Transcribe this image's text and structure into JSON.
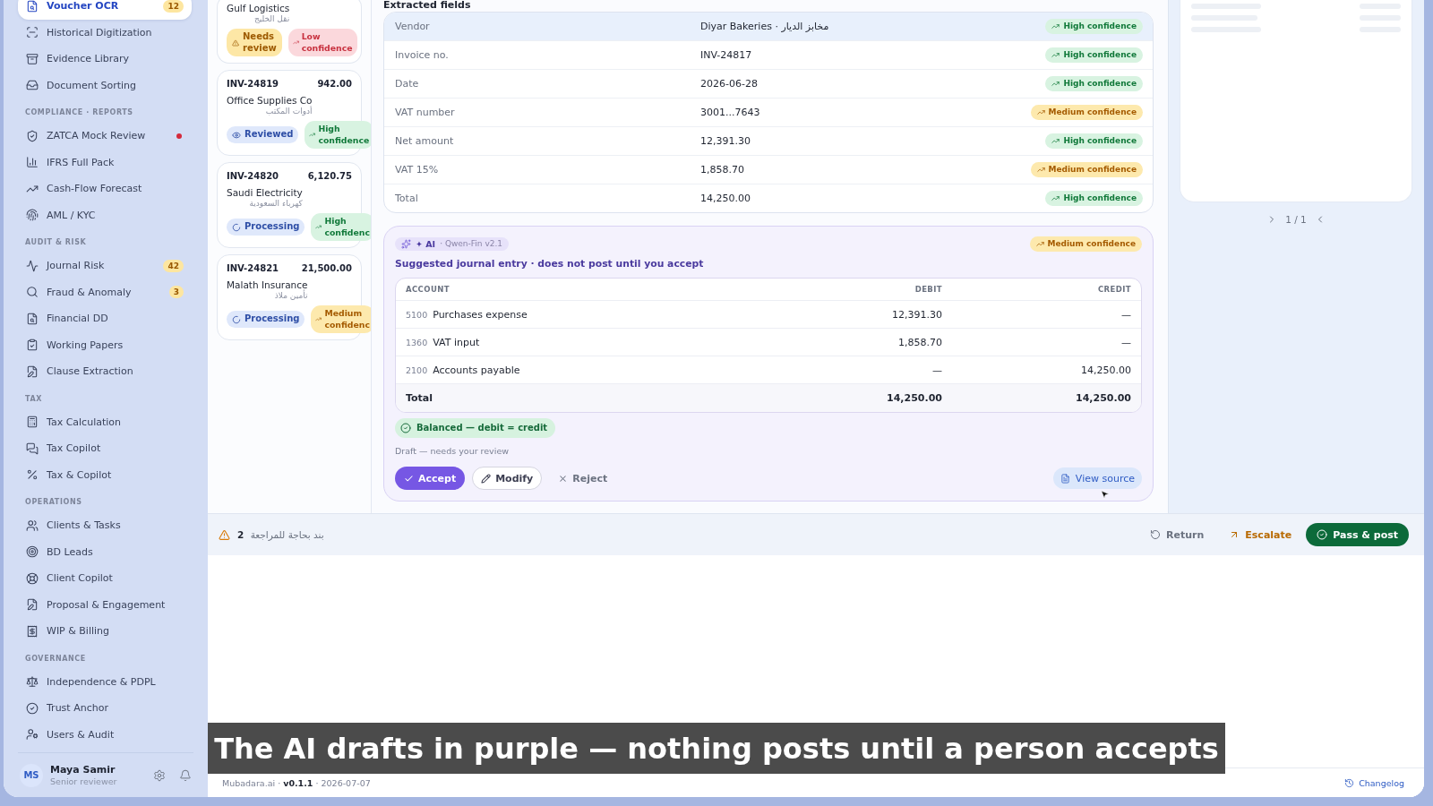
{
  "sidebar": {
    "groups": [
      {
        "items": [
          {
            "label": "Voucher OCR",
            "selected": true,
            "alert": false,
            "badge": "12"
          },
          {
            "label": "Historical Digitization",
            "selected": false,
            "alert": false
          },
          {
            "label": "Evidence Library",
            "selected": false,
            "alert": false
          },
          {
            "label": "Document Sorting",
            "selected": false,
            "alert": false
          }
        ]
      },
      {
        "heading": "COMPLIANCE · REPORTS",
        "items": [
          {
            "label": "ZATCA Mock Review",
            "selected": false,
            "alert": true
          },
          {
            "label": "IFRS Full Pack",
            "selected": false,
            "alert": false
          },
          {
            "label": "Cash-Flow Forecast",
            "selected": false,
            "alert": false
          },
          {
            "label": "AML / KYC",
            "selected": false,
            "alert": false
          }
        ]
      },
      {
        "heading": "AUDIT & RISK",
        "items": [
          {
            "label": "Journal Risk",
            "selected": false,
            "alert": false,
            "badge": "42"
          },
          {
            "label": "Fraud & Anomaly",
            "selected": false,
            "alert": false,
            "badge": "3"
          },
          {
            "label": "Financial DD",
            "selected": false,
            "alert": false
          },
          {
            "label": "Working Papers",
            "selected": false,
            "alert": false
          },
          {
            "label": "Clause Extraction",
            "selected": false,
            "alert": false
          }
        ]
      },
      {
        "heading": "TAX",
        "items": [
          {
            "label": "Tax Calculation",
            "selected": false,
            "alert": false
          },
          {
            "label": "Tax Copilot",
            "selected": false,
            "alert": false
          },
          {
            "label": "Tax & Copilot",
            "selected": false,
            "alert": false
          }
        ]
      },
      {
        "heading": "OPERATIONS",
        "items": [
          {
            "label": "Clients & Tasks",
            "selected": false,
            "alert": false
          },
          {
            "label": "BD Leads",
            "selected": false,
            "alert": false
          },
          {
            "label": "Client Copilot",
            "selected": false,
            "alert": false
          },
          {
            "label": "Proposal & Engagement",
            "selected": false,
            "alert": false
          },
          {
            "label": "WIP & Billing",
            "selected": false,
            "alert": false
          }
        ]
      },
      {
        "heading": "GOVERNANCE",
        "items": [
          {
            "label": "Independence & PDPL",
            "selected": false,
            "alert": false
          },
          {
            "label": "Trust Anchor",
            "selected": false,
            "alert": false
          },
          {
            "label": "Users & Audit",
            "selected": false,
            "alert": false
          }
        ]
      }
    ],
    "user": {
      "initials": "MS",
      "name": "Maya Samir",
      "role": "Senior reviewer"
    }
  },
  "invoices": [
    {
      "vendor": "Gulf Logistics",
      "vendor_ar": "نقل الخليج",
      "status": {
        "kind": "needs_review",
        "label": "Needs review"
      },
      "confidence": {
        "kind": "low",
        "label": "Low confidence"
      }
    },
    {
      "number": "INV-24819",
      "amount": "942.00",
      "vendor": "Office Supplies Co",
      "vendor_ar": "أدوات المكتب",
      "status": {
        "kind": "reviewed",
        "label": "Reviewed"
      },
      "confidence": {
        "kind": "high",
        "label": "High confidence"
      }
    },
    {
      "number": "INV-24820",
      "amount": "6,120.75",
      "vendor": "Saudi Electricity",
      "vendor_ar": "كهرباء السعودية",
      "status": {
        "kind": "processing",
        "label": "Processing"
      },
      "confidence": {
        "kind": "high",
        "label": "High confidenc"
      }
    },
    {
      "number": "INV-24821",
      "amount": "21,500.00",
      "vendor": "Malath Insurance",
      "vendor_ar": "تأمين ملاذ",
      "status": {
        "kind": "processing",
        "label": "Processing"
      },
      "confidence": {
        "kind": "medium",
        "label": "Medium confidenc"
      }
    }
  ],
  "fields": {
    "title": "Extracted fields",
    "rows": [
      {
        "label": "Vendor",
        "value": "Diyar Bakeries · مخابز الديار",
        "selected": true,
        "confidence": {
          "kind": "high",
          "label": "High confidence"
        }
      },
      {
        "label": "Invoice no.",
        "value": "INV-24817",
        "selected": false,
        "confidence": {
          "kind": "high",
          "label": "High confidence"
        }
      },
      {
        "label": "Date",
        "value": "2026-06-28",
        "selected": false,
        "confidence": {
          "kind": "high",
          "label": "High confidence"
        }
      },
      {
        "label": "VAT number",
        "value": "3001...7643",
        "selected": false,
        "confidence": {
          "kind": "medium",
          "label": "Medium confidence"
        }
      },
      {
        "label": "Net amount",
        "value": "12,391.30",
        "selected": false,
        "confidence": {
          "kind": "high",
          "label": "High confidence"
        }
      },
      {
        "label": "VAT 15%",
        "value": "1,858.70",
        "selected": false,
        "confidence": {
          "kind": "medium",
          "label": "Medium confidence"
        }
      },
      {
        "label": "Total",
        "value": "14,250.00",
        "selected": false,
        "confidence": {
          "kind": "high",
          "label": "High confidence"
        }
      }
    ]
  },
  "journal": {
    "tag": "✦ AI",
    "model": "· Qwen-Fin v2.1",
    "confidence": {
      "kind": "medium",
      "label": "Medium confidence"
    },
    "title": "Suggested journal entry · does not post until you accept",
    "columns": [
      "ACCOUNT",
      "DEBIT",
      "CREDIT"
    ],
    "rows": [
      {
        "code": "5100",
        "account": "Purchases expense",
        "debit": "12,391.30",
        "credit": "—"
      },
      {
        "code": "1360",
        "account": "VAT input",
        "debit": "1,858.70",
        "credit": "—"
      },
      {
        "code": "2100",
        "account": "Accounts payable",
        "debit": "—",
        "credit": "14,250.00"
      }
    ],
    "total": {
      "label": "Total",
      "debit": "14,250.00",
      "credit": "14,250.00"
    },
    "balance": "Balanced — debit = credit",
    "note": "Draft — needs your review",
    "actions": [
      {
        "kind": "primary",
        "label": "Accept"
      },
      {
        "kind": "outline",
        "label": "Modify"
      },
      {
        "kind": "ghost",
        "label": "Reject"
      }
    ],
    "source_link": "View source"
  },
  "preview": {
    "page": "1 / 1"
  },
  "review_bar": {
    "summary": "**2** بند بحاجة للمراجعة",
    "actions": [
      {
        "kind": "return",
        "label": "Return"
      },
      {
        "kind": "escalate",
        "label": "Escalate"
      },
      {
        "kind": "post",
        "label": "Pass & post"
      }
    ]
  },
  "footer": {
    "version": "Mubadara.ai · **v0.1.1** · 2026-07-07",
    "changelog": "Changelog"
  },
  "caption": "The AI drafts in purple — nothing posts until a person accepts"
}
